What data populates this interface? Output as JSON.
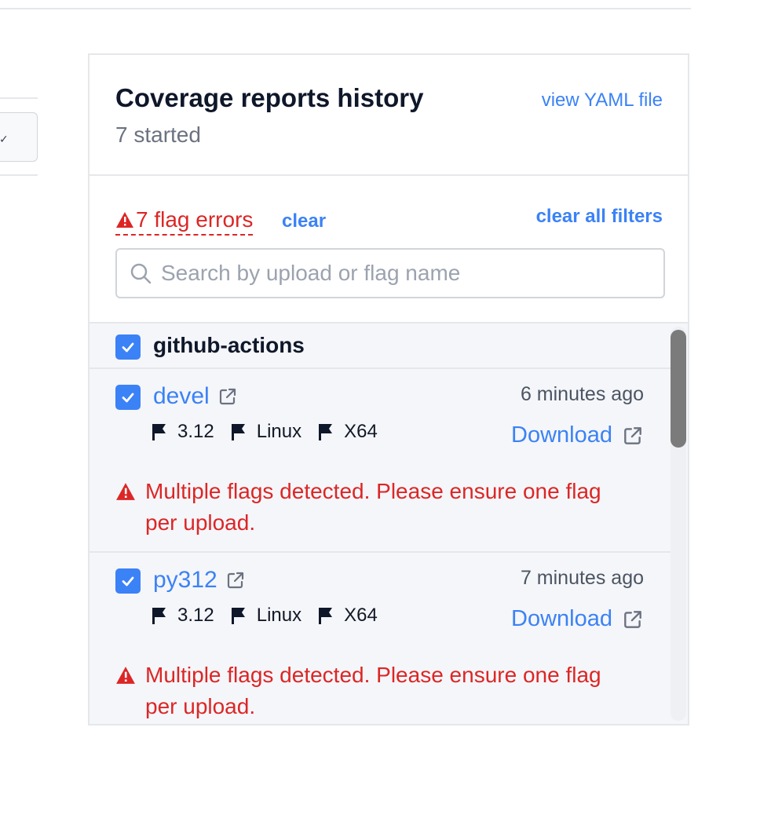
{
  "panel": {
    "title": "Coverage reports history",
    "subtitle": "7 started",
    "view_yaml_label": "view YAML file"
  },
  "filters": {
    "flag_errors_label": "7 flag errors",
    "clear_label": "clear",
    "clear_all_label": "clear all filters",
    "search_placeholder": "Search by upload or flag name",
    "search_value": ""
  },
  "group": {
    "name": "github-actions",
    "checked": true
  },
  "uploads": [
    {
      "name": "devel",
      "time": "6 minutes ago",
      "flags": [
        "3.12",
        "Linux",
        "X64"
      ],
      "download_label": "Download",
      "error": "Multiple flags detected. Please ensure one flag per upload.",
      "checked": true
    },
    {
      "name": "py312",
      "time": "7 minutes ago",
      "flags": [
        "3.12",
        "Linux",
        "X64"
      ],
      "download_label": "Download",
      "error": "Multiple flags detected. Please ensure one flag per upload.",
      "checked": true
    }
  ],
  "icons": {
    "warning": "warning-icon",
    "external_link": "external-link-icon",
    "flag": "flag-icon",
    "search": "search-icon",
    "checkbox": "checkbox-checked-icon"
  },
  "colors": {
    "accent": "#3b82f6",
    "error": "#dc2626",
    "muted": "#6b7280",
    "list_bg": "#f5f6f9"
  }
}
